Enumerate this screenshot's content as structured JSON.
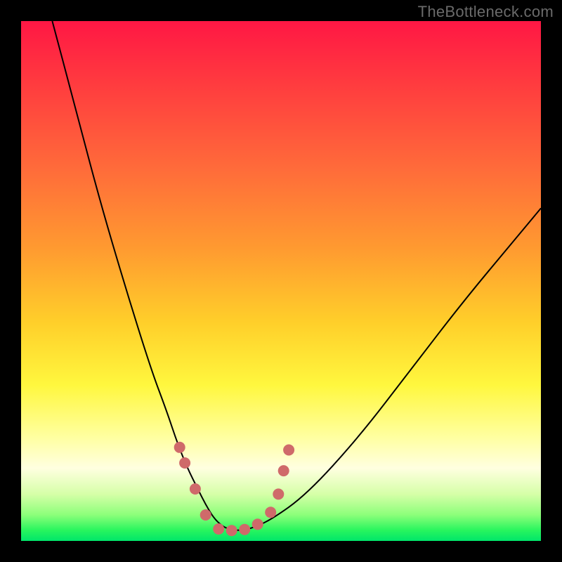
{
  "watermark": {
    "text": "TheBottleneck.com"
  },
  "colors": {
    "frame_bg": "#000000",
    "curve_stroke": "#000000",
    "dot_fill": "#cf6a6a",
    "gradient_stops": [
      "#ff1744",
      "#ff6a3a",
      "#ffcf2a",
      "#ffffe0",
      "#00e56a"
    ]
  },
  "chart_data": {
    "type": "line",
    "title": "",
    "xlabel": "",
    "ylabel": "",
    "xlim": [
      0,
      100
    ],
    "ylim": [
      0,
      100
    ],
    "series": [
      {
        "name": "bottleneck-curve",
        "x": [
          6,
          10,
          15,
          20,
          25,
          28,
          30,
          32,
          34,
          35.5,
          37,
          38.5,
          40,
          42,
          44,
          48,
          55,
          65,
          75,
          85,
          95,
          100
        ],
        "y": [
          100,
          85,
          66,
          49,
          33,
          25,
          19,
          14,
          10,
          7,
          4.5,
          3,
          2.2,
          2,
          2.3,
          4,
          9,
          20,
          33,
          46,
          58,
          64
        ]
      }
    ],
    "annotations": {
      "dots": [
        {
          "x": 30.5,
          "y": 18
        },
        {
          "x": 31.5,
          "y": 15
        },
        {
          "x": 33.5,
          "y": 10
        },
        {
          "x": 35.5,
          "y": 5
        },
        {
          "x": 38.0,
          "y": 2.3
        },
        {
          "x": 40.5,
          "y": 2.0
        },
        {
          "x": 43.0,
          "y": 2.2
        },
        {
          "x": 45.5,
          "y": 3.2
        },
        {
          "x": 48.0,
          "y": 5.5
        },
        {
          "x": 49.5,
          "y": 9.0
        },
        {
          "x": 50.5,
          "y": 13.5
        },
        {
          "x": 51.5,
          "y": 17.5
        }
      ]
    }
  }
}
